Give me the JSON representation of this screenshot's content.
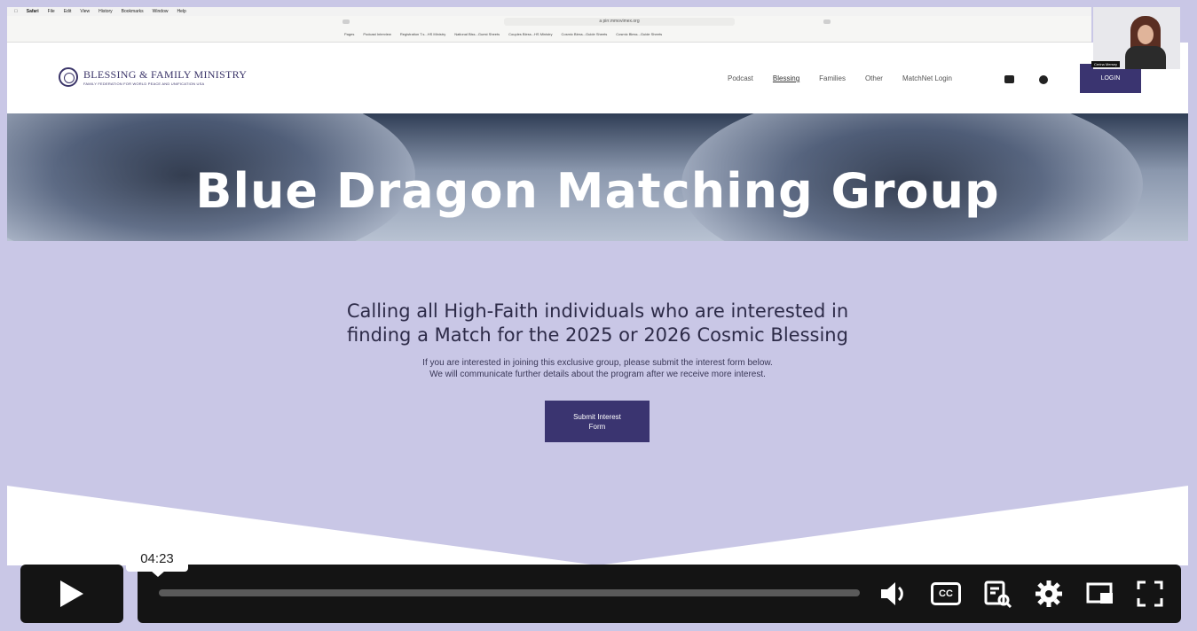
{
  "menubar": {
    "apple_icon": "apple-icon",
    "items": [
      "Safari",
      "File",
      "Edit",
      "View",
      "History",
      "Bookmarks",
      "Window",
      "Help"
    ]
  },
  "browser": {
    "url": "a   pirr.mmovimex.org",
    "favorites": [
      "Pages",
      "Podcast Interview",
      "Registration T.s...HS Ministry",
      "National Blss...Guest Sheets",
      "Couples Bless...HS Ministry",
      "Cosmic Bless...Guide Sheets",
      "Cosmic Bless...Guide Sheets"
    ]
  },
  "site": {
    "logo_title": "BLESSING & FAMILY MINISTRY",
    "logo_subtitle": "FAMILY FEDERATION FOR WORLD PEACE AND UNIFICATION USA",
    "nav": [
      "Podcast",
      "Blessing",
      "Families",
      "Other",
      "MatchNet Login"
    ],
    "active_nav": "Blessing",
    "login_label": "LOGIN",
    "social": [
      "youtube-icon",
      "spotify-icon"
    ]
  },
  "presenter": {
    "name_tag": "Cerina Mersey"
  },
  "hero": {
    "title": "Blue Dragon Matching Group"
  },
  "content": {
    "heading_line1": "Calling all High-Faith individuals who are interested in",
    "heading_line2": "finding a Match for the 2025 or 2026 Cosmic Blessing",
    "sub_line1": "If you are interested in joining this exclusive group, please submit the interest form below.",
    "sub_line2": "We will communicate further details about the program after we receive more interest.",
    "button_line1": "Submit Interest",
    "button_line2": "Form"
  },
  "player": {
    "time": "04:23",
    "progress_fraction": 0.0,
    "controls": [
      "volume-icon",
      "captions-icon",
      "transcript-icon",
      "settings-icon",
      "pip-icon",
      "fullscreen-icon"
    ],
    "cc_label": "CC"
  },
  "colors": {
    "accent": "#3a3470",
    "page_bg": "#c9c7e6",
    "player_bg": "#141414"
  }
}
